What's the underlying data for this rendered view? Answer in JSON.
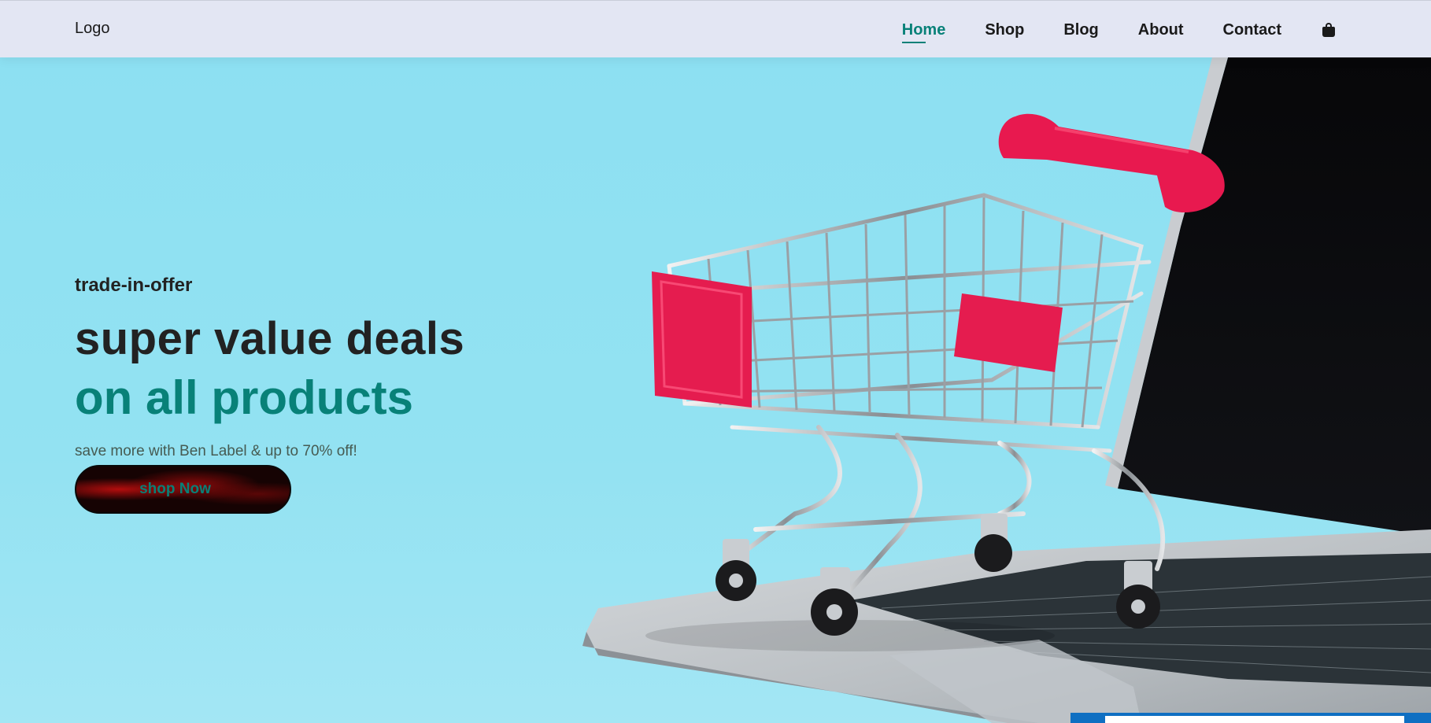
{
  "header": {
    "logo": "Logo",
    "nav": [
      {
        "label": "Home",
        "active": true
      },
      {
        "label": "Shop",
        "active": false
      },
      {
        "label": "Blog",
        "active": false
      },
      {
        "label": "About",
        "active": false
      },
      {
        "label": "Contact",
        "active": false
      }
    ],
    "cart_icon": "shopping-bag-icon"
  },
  "hero": {
    "eyebrow": "trade-in-offer",
    "headline": "super value deals",
    "headline_accent": "on all products",
    "subtext": "save more with Ben Label & up to 70% off!",
    "button_label": "shop Now",
    "image": "shopping-cart-on-laptop"
  },
  "colors": {
    "accent": "#088178",
    "header_bg": "#e3e6f3",
    "hero_bg": "#8fe0f0",
    "text_dark": "#222222",
    "cart_red": "#e8194f"
  }
}
